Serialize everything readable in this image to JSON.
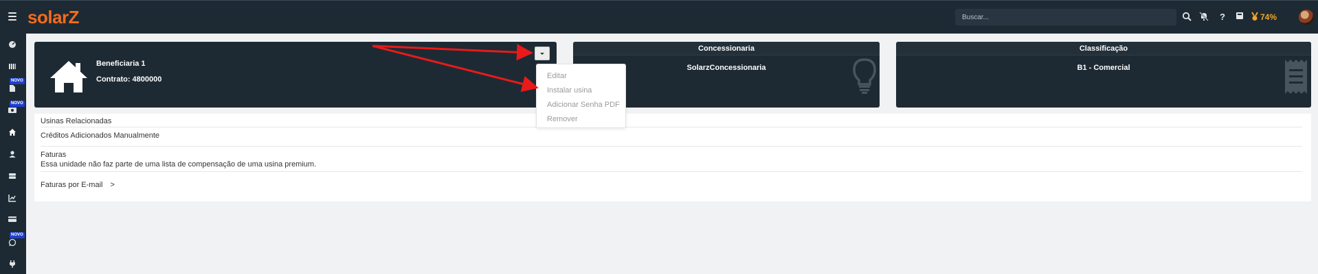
{
  "app": {
    "logo": "solarZ"
  },
  "topbar": {
    "search_placeholder": "Buscar...",
    "icons": [
      "search-icon",
      "bell-off-icon",
      "help-icon",
      "calculator-icon",
      "badge-icon"
    ],
    "percent": "74%"
  },
  "sidebar": {
    "items": [
      {
        "icon": "dashboard-icon"
      },
      {
        "icon": "list-icon"
      },
      {
        "icon": "document-icon",
        "badge": "NOVO"
      },
      {
        "icon": "money-icon",
        "badge": "NOVO"
      },
      {
        "icon": "home-icon"
      },
      {
        "icon": "user-icon"
      },
      {
        "icon": "server-icon"
      },
      {
        "icon": "chart-icon"
      },
      {
        "icon": "card-icon"
      },
      {
        "icon": "whatsapp-icon",
        "badge": "NOVO"
      },
      {
        "icon": "plug-icon"
      }
    ]
  },
  "unit_card": {
    "name": "Beneficiaria 1",
    "contract": "Contrato: 4800000"
  },
  "dropdown": {
    "items": [
      "Editar",
      "Instalar usina",
      "Adicionar Senha PDF",
      "Remover"
    ]
  },
  "concessionaria_card": {
    "title": "Concessionaria",
    "value": "SolarzConcessionaria"
  },
  "classificacao_card": {
    "title": "Classificação",
    "value": "B1 - Comercial"
  },
  "sections": {
    "usinas": "Usinas Relacionadas",
    "creditos": "Créditos Adicionados Manualmente",
    "faturas": "Faturas",
    "faturas_msg": "Essa unidade não faz parte de uma lista de compensação de uma usina premium.",
    "faturas_email": "Faturas por E-mail",
    "faturas_email_chevron": ">"
  },
  "colors": {
    "accent": "#f26b1d",
    "nav_bg": "#1e2a33",
    "annotation": "#e81a1a"
  }
}
